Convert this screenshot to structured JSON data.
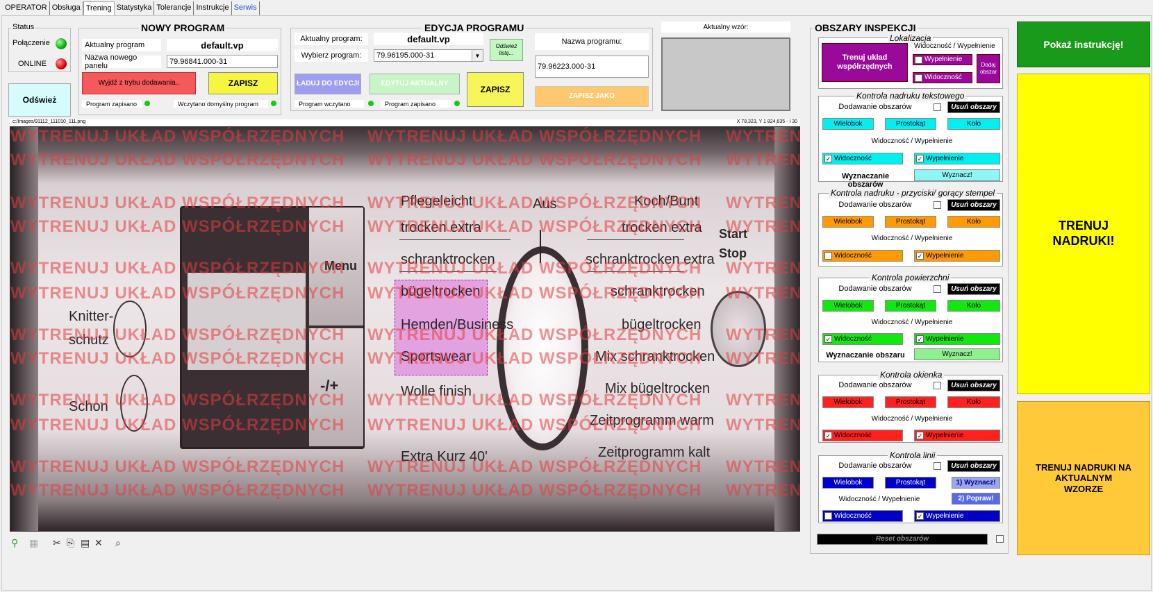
{
  "tabs": [
    {
      "label": "OPERATOR"
    },
    {
      "label": "Obsługa"
    },
    {
      "label": "Trening"
    },
    {
      "label": "Statystyka"
    },
    {
      "label": "Tolerancje"
    },
    {
      "label": "Instrukcje"
    },
    {
      "label": "Serwis"
    }
  ],
  "status": {
    "legend": "Status",
    "connection_label": "Połączenie",
    "online_label": "ONLINE",
    "connection_color": "#22c522",
    "online_color": "#e01010",
    "refresh_label": "Odśwież"
  },
  "new_program": {
    "title": "NOWY PROGRAM",
    "current_label": "Aktualny program",
    "current_value": "default.vp",
    "panel_name_label": "Nazwa nowego panelu",
    "panel_name_value": "79.96841.000-31",
    "exit_label": "Wyjdź z trybu dodawania..",
    "save_label": "ZAPISZ",
    "saved_indicator": "Program zapisano",
    "default_loaded_indicator": "Wczytano domyślny program"
  },
  "edit_program": {
    "title": "EDYCJA PROGRAMU",
    "current_label": "Aktualny program:",
    "current_value": "default.vp",
    "select_label": "Wybierz program:",
    "select_value": "79.96195.000-31",
    "refresh_list_label": "Odśwież listę...",
    "load_label": "ŁADUJ DO EDYCJI",
    "edit_current_label": "EDYTUJ AKTUALNY",
    "save_label": "ZAPISZ",
    "loaded_indicator": "Program wczytano",
    "saved_indicator": "Program zapisano",
    "program_name_label": "Nazwa programu:",
    "program_name_value": "79.96223.000-31",
    "save_as_label": "ZAPISZ JAKO"
  },
  "current_pattern": {
    "label": "Aktualny wzór:"
  },
  "image": {
    "path": "c:/Images/91112_111010_111.png",
    "coords": "X 78,323, Y 1 824,635 - I 30",
    "watermark": "WYTRENUJ UKŁAD WSPÓŁRZĘDNYCH",
    "panel_texts": {
      "menu": "Menu",
      "plusminus": "-/+",
      "knitter": "Knitter-",
      "schutz": "schutz",
      "schon": "Schon",
      "aus": "Aus",
      "start": "Start",
      "stop": "Stop",
      "left_programs": [
        "Pflegeleicht",
        "trocken extra",
        "schranktrocken",
        "bügeltrocken",
        "Hemden/Business",
        "Sportswear",
        "Wolle finish",
        "Extra Kurz 40'"
      ],
      "right_programs": [
        "Koch/Bunt",
        "trocken extra",
        "schranktrocken extra",
        "schranktrocken",
        "bügeltrocken",
        "Mix schranktrocken",
        "Mix bügeltrocken",
        "Zeitprogramm warm",
        "Zeitprogramm kalt"
      ]
    }
  },
  "inspection": {
    "title": "OBSZARY INSPEKCJI",
    "localization": {
      "title": "Lokalizacja",
      "train_button": "Trenuj układ współrzędnych",
      "vis_fill_label": "Widoczność / Wypełnienie",
      "fill_label": "Wypełnienie",
      "visibility_label": "Widoczność",
      "add_area_label": "Dodaj obszar",
      "color": "#9a0a9a"
    },
    "sections": [
      {
        "title": "Kontrola nadruku tekstowego",
        "add_label": "Dodawanie obszarów",
        "remove_label": "Usuń obszary",
        "polygon": "Wielobok",
        "rect": "Prostokąt",
        "circle": "Koło",
        "vis_fill": "Widoczność / Wypełnienie",
        "visibility": "Widoczność",
        "fill": "Wypełnienie",
        "extra_label": "Wyznaczanie obszarów",
        "extra_button": "Wyznacz!",
        "color": "#00f0f0"
      },
      {
        "title": "Kontrola nadruku - przyciski/ gorący stempel",
        "add_label": "Dodawanie obszarów",
        "remove_label": "Usuń obszary",
        "polygon": "Wielobok",
        "rect": "Prostokąt",
        "circle": "Koło",
        "vis_fill": "Widoczność / Wypełnienie",
        "visibility": "Widoczność",
        "fill": "Wypełnienie",
        "color": "#ff9a00"
      },
      {
        "title": "Kontrola powierzchni",
        "add_label": "Dodawanie obszarów",
        "remove_label": "Usuń obszary",
        "polygon": "Wielobok",
        "rect": "Prostokąt",
        "circle": "Koło",
        "vis_fill": "Widoczność / Wypełnienie",
        "visibility": "Widoczność",
        "fill": "Wypełnienie",
        "extra_label": "Wyznaczanie obszaru",
        "extra_button": "Wyznacz!",
        "color": "#10e810"
      },
      {
        "title": "Kontrola okienka",
        "add_label": "Dodawanie obszarów",
        "remove_label": "Usuń obszary",
        "polygon": "Wielobok",
        "rect": "Prostokąt",
        "circle": "Koło",
        "vis_fill": "Widoczność / Wypełnienie",
        "visibility": "Widoczność",
        "fill": "Wypełnienie",
        "color": "#ff2020"
      },
      {
        "title": "Kontrola linii",
        "add_label": "Dodawanie obszarów",
        "remove_label": "Usuń obszary",
        "polygon": "Wielobok",
        "rect": "Prostokąt",
        "mark_button": "1) Wyznacz!",
        "fix_button": "2) Popraw!",
        "vis_fill": "Widoczność / Wypełnienie",
        "visibility": "Widoczność",
        "fill": "Wypełnienie",
        "color": "#0000c8"
      }
    ],
    "reset_label": "Reset obszarów"
  },
  "right_buttons": {
    "show_instruction": "Pokaż instrukcję!",
    "train_prints": "TRENUJ NADRUKI!",
    "train_on_current": "TRENUJ NADRUKI NA AKTUALNYM WZORZE"
  }
}
